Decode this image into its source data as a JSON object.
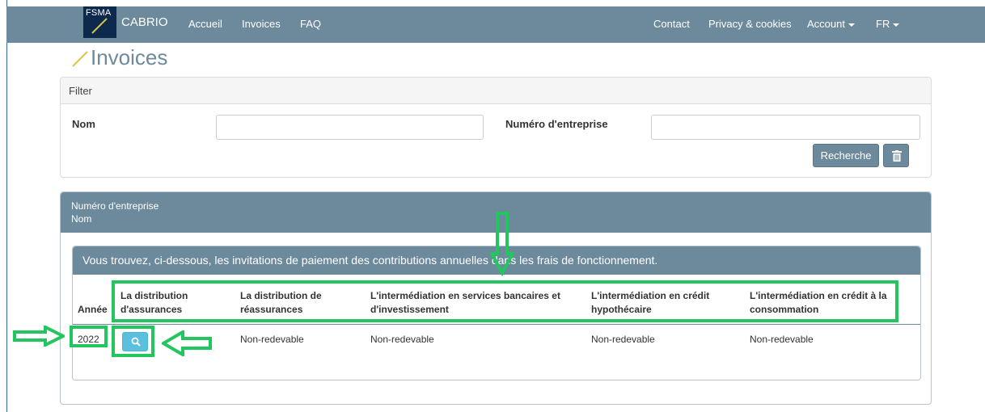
{
  "navbar": {
    "logo_text": "FSMA",
    "brand": "CABRIO",
    "links": [
      "Accueil",
      "Invoices",
      "FAQ"
    ],
    "right_links": [
      "Contact",
      "Privacy & cookies"
    ],
    "account": "Account",
    "language": "FR"
  },
  "page": {
    "title": "Invoices"
  },
  "filter": {
    "heading": "Filter",
    "name_label": "Nom",
    "name_value": "",
    "company_label": "Numéro d'entreprise",
    "company_value": "",
    "search_button": "Recherche"
  },
  "results": {
    "company_number_label": "Numéro d'entreprise",
    "name_label": "Nom",
    "intro": "Vous trouvez, ci-dessous, les invitations de paiement des contributions annuelles dans les frais de fonctionnement.",
    "columns": [
      "Année",
      "La distribution d'assurances",
      "La distribution de réassurances",
      "L'intermédiation en services bancaires et d'investissement",
      "L'intermédiation en crédit hypothécaire",
      "L'intermédiation en crédit à la consommation"
    ],
    "rows": [
      {
        "year": "2022",
        "reassurances": "Non-redevable",
        "banking": "Non-redevable",
        "mortgage": "Non-redevable",
        "consumer": "Non-redevable"
      }
    ]
  },
  "colors": {
    "navbar": "#6c8a9c",
    "logo": "#0d2a4e",
    "highlight": "#22c55e",
    "view_button": "#5bc0de"
  },
  "icons": {
    "logo": "slash-logo-icon",
    "trash": "trash-icon",
    "view": "search-icon",
    "annotations": "arrow-icon"
  }
}
